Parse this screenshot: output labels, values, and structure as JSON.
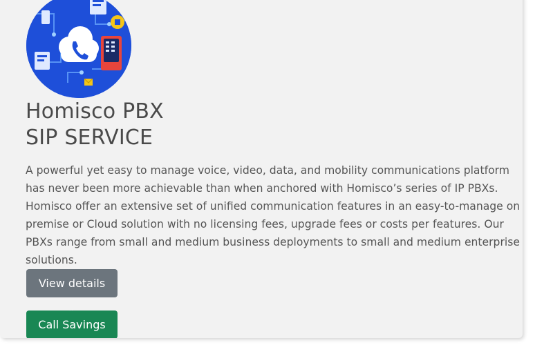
{
  "card": {
    "illustration": {
      "icon": "cloud-phone-icon",
      "colors": {
        "background": "#1e4fd9",
        "accent": "#f5c518",
        "cloud": "#ffffff",
        "accent_red": "#e8453c"
      }
    },
    "title_line1": "Homisco PBX",
    "title_line2": "SIP SERVICE",
    "description": "A powerful yet easy to manage voice, video, data, and mobility communications platform has never been more achievable than when anchored with Homisco’s series of IP PBXs. Homisco offer an extensive set of unified communication features in an easy-to-manage on premise or Cloud solution with no licensing fees, upgrade fees or costs per features. Our PBXs range from small and medium business deployments to small and medium enterprise solutions.",
    "buttons": {
      "view_details": "View details »",
      "call_savings": "Call Savings »"
    },
    "colors": {
      "card_background": "#f2f2f2",
      "title_text": "#4a4a4a",
      "body_text": "#555555",
      "secondary_button": "#6c757d",
      "success_button": "#198754"
    }
  }
}
